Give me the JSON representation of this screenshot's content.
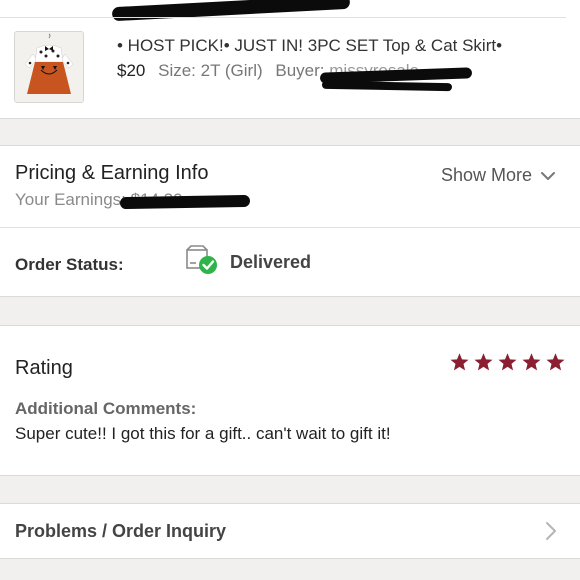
{
  "item": {
    "title": "• HOST PICK!• JUST IN! 3PC SET Top & Cat Skirt•",
    "price": "$20",
    "size_label": "Size:",
    "size_value": "2T (Girl)",
    "buyer_label": "Buyer:",
    "buyer_name": "missyrosale"
  },
  "pricing": {
    "title": "Pricing & Earning Info",
    "earnings_label": "Your Earnings:",
    "earnings_value": "$14.30",
    "show_more": "Show More"
  },
  "order_status": {
    "label": "Order Status:",
    "value": "Delivered",
    "icon": "package-delivered-icon"
  },
  "rating": {
    "title": "Rating",
    "stars": 5,
    "star_color": "#8b1f32",
    "comments_label": "Additional Comments:",
    "comments_text": "Super cute!! I got this for a gift.. can't wait to gift it!"
  },
  "problems": {
    "label": "Problems / Order Inquiry"
  },
  "colors": {
    "separator": "#f1f0ee",
    "check_green": "#2fb34a",
    "star": "#8b1f32"
  }
}
